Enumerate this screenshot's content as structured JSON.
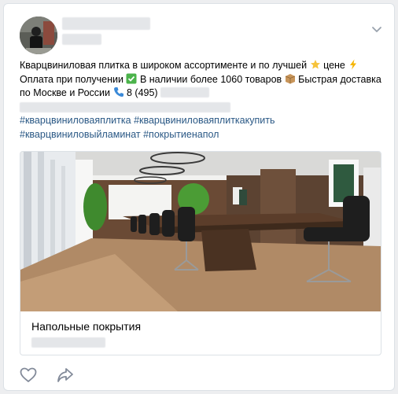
{
  "post": {
    "text": {
      "line1_a": "Кварцвиниловая плитка в широком ассортименте и по лучшей",
      "line1_b": "цене",
      "line1_c": "Оплата при получении",
      "line2_b": "В наличии более 1060 товаров",
      "line2_c": "Быстрая доставка по Москве и России",
      "phone": "8 (495)"
    },
    "tags": [
      "#кварцвиниловаяплитка",
      "#кварцвиниловаяплиткакупить",
      "#кварцвиниловыйламинат",
      "#покрытиенапол"
    ],
    "attachment": {
      "title": "Напольные покрытия"
    }
  },
  "colors": {
    "link": "#2a5885",
    "icon": "#828a99",
    "border": "#dce1e6"
  },
  "icons": [
    "chevron-down-icon",
    "star-emoji",
    "lightning-emoji",
    "check-emoji",
    "box-emoji",
    "phone-emoji",
    "like-icon",
    "share-icon"
  ]
}
